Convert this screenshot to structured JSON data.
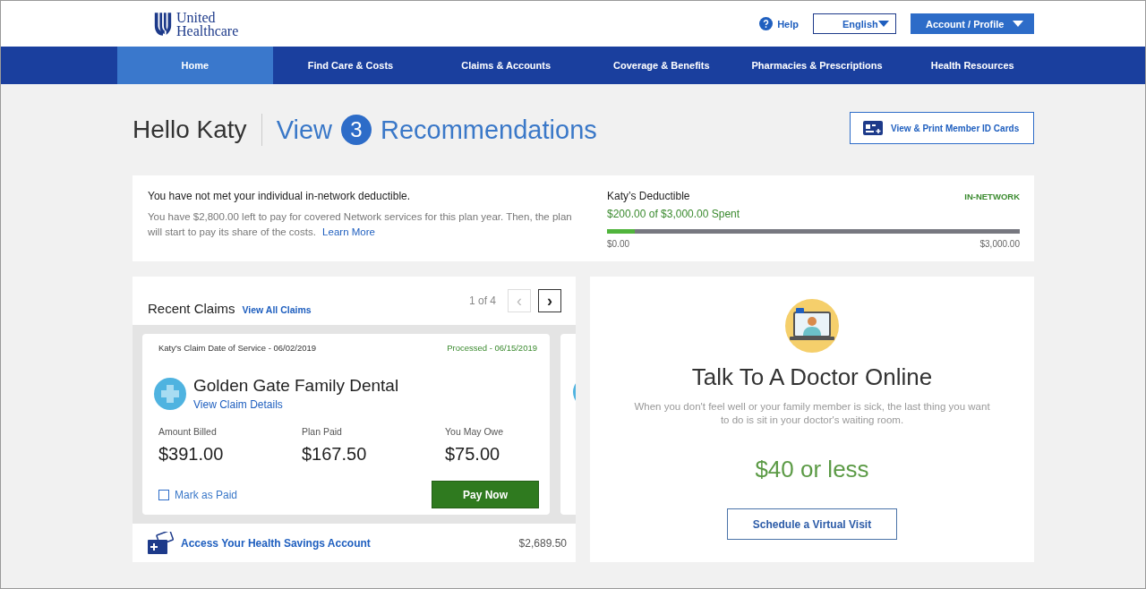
{
  "header": {
    "logo": {
      "line_1": "United",
      "line_2": "Healthcare"
    },
    "help": "Help",
    "language": "English",
    "account": "Account / Profile"
  },
  "nav": [
    {
      "label": "Home",
      "selected": true
    },
    {
      "label": "Find Care & Costs",
      "selected": false
    },
    {
      "label": "Claims & Accounts",
      "selected": false
    },
    {
      "label": "Coverage & Benefits",
      "selected": false
    },
    {
      "label": "Pharmacies & Prescriptions",
      "selected": false
    },
    {
      "label": "Health Resources",
      "selected": false
    }
  ],
  "greeting": {
    "text": "Hello Katy",
    "view": "View",
    "count": "3",
    "recommendations": "Recommendations",
    "id_cards_button": "View & Print Member ID Cards"
  },
  "deductible": {
    "message": "You have not met your individual in-network deductible.",
    "detail": "You have $2,800.00 left to pay for covered Network services for this plan year. Then, the plan will start to pay its share of the costs.",
    "learn_more": "Learn More",
    "title": "Katy’s Deductible",
    "network": "IN-NETWORK",
    "spent": "$200.00 of $3,000.00 Spent",
    "level": 0.067,
    "min": "$0.00",
    "max": "$3,000.00"
  },
  "claims": {
    "title": "Recent Claims",
    "view_all": "View All Claims",
    "pager": "1 of 4",
    "prev": "‹",
    "next": "›",
    "cards": [
      {
        "date_of_service": "Katy's Claim Date of Service - 06/02/2019",
        "status": "Processed - 06/15/2019",
        "provider": "Golden Gate Family Dental",
        "details_link": "View Claim Details",
        "amounts": [
          {
            "label": "Amount Billed",
            "value": "$391.00"
          },
          {
            "label": "Plan Paid",
            "value": "$167.50"
          },
          {
            "label": "You May Owe",
            "value": "$75.00"
          }
        ],
        "mark_paid": {
          "label": "Mark as Paid",
          "checked": false
        },
        "pay_button": "Pay Now"
      }
    ],
    "hsa": {
      "label": "Access Your Health Savings Account",
      "balance": "$2,689.50"
    }
  },
  "promo": {
    "title": "Talk To A Doctor Online",
    "text": "When you don't feel well or your family member is sick, the last thing you want to do is sit in your doctor's waiting room.",
    "price": "$40 or less",
    "button": "Schedule a Virtual Visit"
  }
}
